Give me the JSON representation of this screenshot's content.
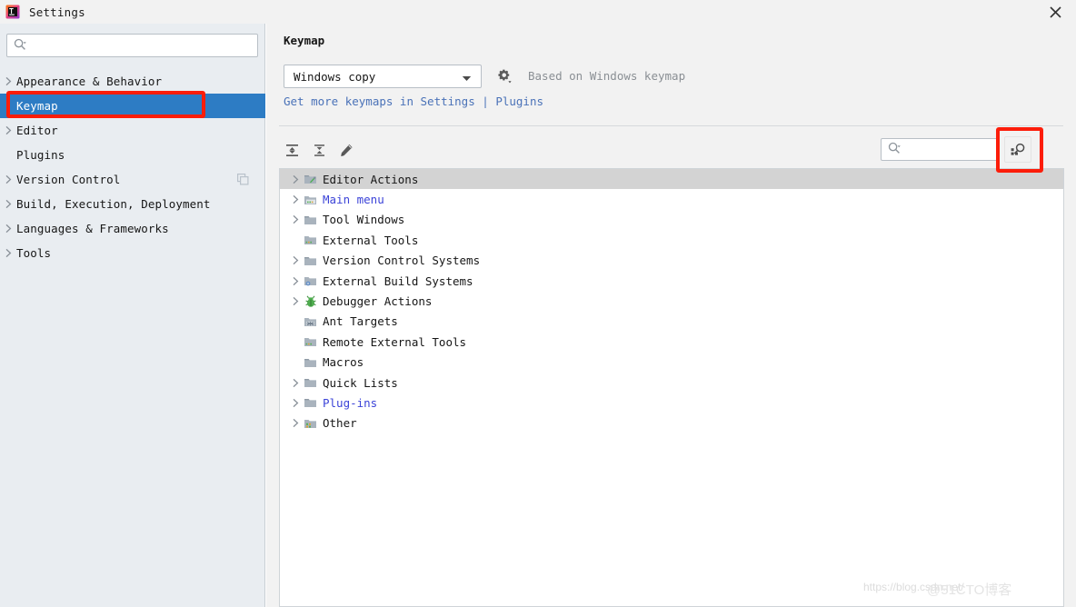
{
  "window": {
    "title": "Settings",
    "app_icon": "intellij-idea-icon",
    "close_icon": "close-icon"
  },
  "sidebar": {
    "search": {
      "value": "",
      "placeholder": "",
      "icon": "search-icon"
    },
    "items": [
      {
        "label": "Appearance & Behavior",
        "expandable": true,
        "selected": false,
        "trailing_icon": ""
      },
      {
        "label": "Keymap",
        "expandable": false,
        "selected": true,
        "trailing_icon": ""
      },
      {
        "label": "Editor",
        "expandable": true,
        "selected": false,
        "trailing_icon": ""
      },
      {
        "label": "Plugins",
        "expandable": false,
        "selected": false,
        "trailing_icon": ""
      },
      {
        "label": "Version Control",
        "expandable": true,
        "selected": false,
        "trailing_icon": "copy-icon"
      },
      {
        "label": "Build, Execution, Deployment",
        "expandable": true,
        "selected": false,
        "trailing_icon": ""
      },
      {
        "label": "Languages & Frameworks",
        "expandable": true,
        "selected": false,
        "trailing_icon": ""
      },
      {
        "label": "Tools",
        "expandable": true,
        "selected": false,
        "trailing_icon": ""
      }
    ]
  },
  "main": {
    "panel_title": "Keymap",
    "keymap_select": {
      "value": "Windows copy",
      "chevron_icon": "chevron-down-icon"
    },
    "gear_icon": "gear-icon",
    "based_on_text": "Based on Windows keymap",
    "more_keymaps": {
      "prefix": "Get more keymaps in ",
      "settings_link": "Settings",
      "separator": " | ",
      "plugins_link": "Plugins"
    },
    "toolbar": [
      {
        "name": "expand-all-icon",
        "tooltip": "Expand All"
      },
      {
        "name": "collapse-all-icon",
        "tooltip": "Collapse All"
      },
      {
        "name": "edit-pencil-icon",
        "tooltip": "Edit Shortcut"
      }
    ],
    "filter_search": {
      "value": "",
      "placeholder": "",
      "icon": "search-icon"
    },
    "shortcut_search_button": {
      "icon": "search-by-shortcut-icon"
    },
    "action_tree": [
      {
        "label": "Editor Actions",
        "expandable": true,
        "icon": "editor-actions-folder-icon",
        "highlight": true,
        "link": false
      },
      {
        "label": "Main menu",
        "expandable": true,
        "icon": "main-menu-folder-icon",
        "highlight": false,
        "link": true
      },
      {
        "label": "Tool Windows",
        "expandable": true,
        "icon": "folder-icon",
        "highlight": false,
        "link": false
      },
      {
        "label": "External Tools",
        "expandable": false,
        "icon": "external-tools-folder-icon",
        "highlight": false,
        "link": false
      },
      {
        "label": "Version Control Systems",
        "expandable": true,
        "icon": "folder-icon",
        "highlight": false,
        "link": false
      },
      {
        "label": "External Build Systems",
        "expandable": true,
        "icon": "build-folder-icon",
        "highlight": false,
        "link": false
      },
      {
        "label": "Debugger Actions",
        "expandable": true,
        "icon": "debugger-bug-icon",
        "highlight": false,
        "link": false
      },
      {
        "label": "Ant Targets",
        "expandable": false,
        "icon": "ant-folder-icon",
        "highlight": false,
        "link": false
      },
      {
        "label": "Remote External Tools",
        "expandable": false,
        "icon": "external-tools-folder-icon",
        "highlight": false,
        "link": false
      },
      {
        "label": "Macros",
        "expandable": false,
        "icon": "folder-icon",
        "highlight": false,
        "link": false
      },
      {
        "label": "Quick Lists",
        "expandable": true,
        "icon": "folder-icon",
        "highlight": false,
        "link": false
      },
      {
        "label": "Plug-ins",
        "expandable": true,
        "icon": "folder-icon",
        "highlight": false,
        "link": true
      },
      {
        "label": "Other",
        "expandable": true,
        "icon": "other-folder-icon",
        "highlight": false,
        "link": false
      }
    ]
  },
  "watermark": {
    "url": "https://blog.csdn.net/",
    "overlay": "@51CTO博客"
  },
  "colors": {
    "selection_blue": "#2d7cc4",
    "annotation_red": "#fc1d0a",
    "link_blue": "#3b43d8",
    "sidebar_bg": "#e9edf1",
    "panel_bg": "#f2f2f2",
    "row_highlight": "#d3d3d3"
  }
}
